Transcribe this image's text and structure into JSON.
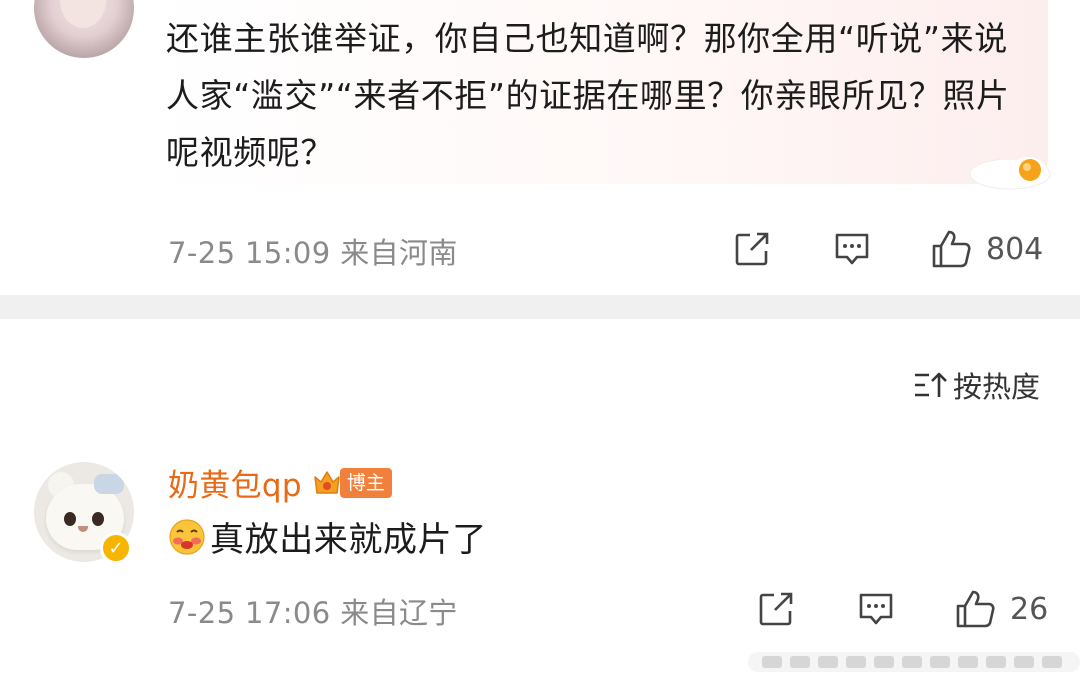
{
  "comment1": {
    "text": "还谁主张谁举证，你自己也知道啊？那你全用“听说”来说人家“滥交”“来者不拒”的证据在哪里？你亲眼所见？照片呢视频呢？",
    "time_location": "7-25 15:09  来自河南",
    "likes": "804"
  },
  "sort": {
    "label": "按热度"
  },
  "comment2": {
    "username": "奶黄包qp",
    "badge": "博主",
    "text": "真放出来就成片了",
    "time_location": "7-25 17:06  来自辽宁",
    "likes": "26"
  },
  "icons": [
    "share-icon",
    "comment-icon",
    "thumbs-up-icon",
    "sort-icon",
    "crown-icon",
    "verified-icon",
    "blushing-emoji-icon",
    "fried-egg-sticker"
  ],
  "colors": {
    "username": "#e86a17",
    "badge": "#f0803c",
    "verified": "#f7b500",
    "meta_text": "#8a8a8a",
    "divider": "#f0f0f0"
  }
}
